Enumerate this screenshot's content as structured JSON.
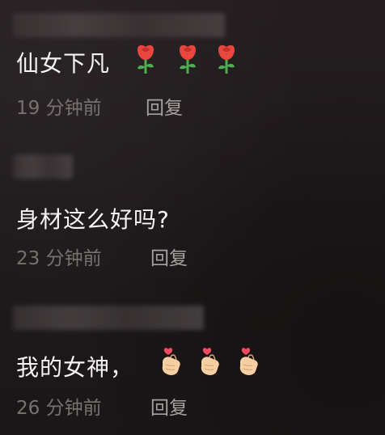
{
  "comments": [
    {
      "text": "仙女下凡",
      "time": "19 分钟前",
      "reply_label": "回复",
      "emoji_icon": "rose-icon",
      "emoji_count": 3
    },
    {
      "text": "身材这么好吗?",
      "time": "23 分钟前",
      "reply_label": "回复"
    },
    {
      "text": "我的女神，",
      "time": "26 分钟前",
      "reply_label": "回复",
      "emoji_icon": "finger-heart-icon",
      "emoji_count": 3
    }
  ],
  "colors": {
    "background": "#1f1a1b",
    "text": "#f4f4f4",
    "meta": "#77716f",
    "reply": "#a7a1a0",
    "rose": "#e8473f",
    "stem": "#4caf50",
    "hand": "#f7cfa3",
    "heart": "#f24b5d"
  }
}
